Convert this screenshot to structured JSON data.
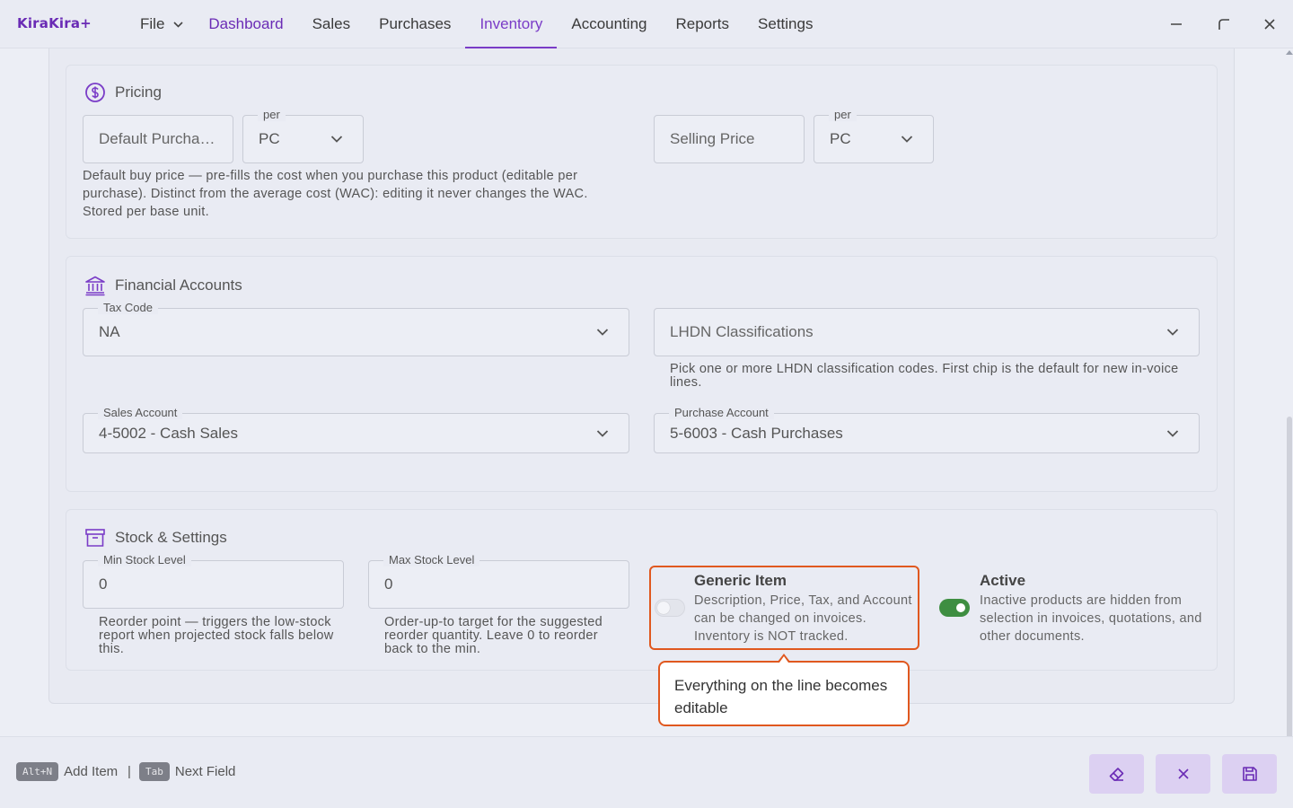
{
  "app": {
    "logo": "KiraKira+"
  },
  "menu": {
    "file": "File",
    "items": [
      "Dashboard",
      "Sales",
      "Purchases",
      "Inventory",
      "Accounting",
      "Reports",
      "Settings"
    ]
  },
  "pricing": {
    "title": "Pricing",
    "purchase_price_placeholder": "Default Purcha…",
    "purchase_unit_legend": "per",
    "purchase_unit": "PC",
    "purchase_help": "Default buy price — pre-fills the cost when you purchase this product (editable per purchase). Distinct from the average cost (WAC): editing it never changes the WAC. Stored per base unit.",
    "selling_price_placeholder": "Selling Price",
    "selling_unit_legend": "per",
    "selling_unit": "PC"
  },
  "financial": {
    "title": "Financial Accounts",
    "tax_code_legend": "Tax Code",
    "tax_code": "NA",
    "lhdn_placeholder": "LHDN Classifications",
    "lhdn_help": "Pick one or more LHDN classification codes. First chip is the default for new in-voice lines.",
    "sales_account_legend": "Sales Account",
    "sales_account": "4-5002 - Cash Sales",
    "purchase_account_legend": "Purchase Account",
    "purchase_account": "5-6003 - Cash Purchases"
  },
  "stock": {
    "title": "Stock & Settings",
    "min_legend": "Min Stock Level",
    "min_value": "0",
    "min_help": "Reorder point — triggers the low-stock report when projected stock falls below this.",
    "max_legend": "Max Stock Level",
    "max_value": "0",
    "max_help": "Order-up-to target for the suggested reorder quantity. Leave 0 to reorder back to the min.",
    "generic_title": "Generic Item",
    "generic_desc": "Description, Price, Tax, and Account can be changed on invoices. Inventory is NOT tracked.",
    "generic_on": false,
    "active_title": "Active",
    "active_desc": "Inactive products are hidden from selection in invoices, quotations, and other documents.",
    "active_on": true
  },
  "tooltip": {
    "text": "Everything on the line becomes editable"
  },
  "footer": {
    "hint1_key": "Alt+N",
    "hint1_label": "Add Item",
    "separator": "|",
    "hint2_key": "Tab",
    "hint2_label": "Next Field"
  },
  "colors": {
    "accent": "#6a2bb5",
    "highlight": "#e0581f",
    "toggle_on": "#3e8e41",
    "action_button": "#dcd0f2"
  }
}
